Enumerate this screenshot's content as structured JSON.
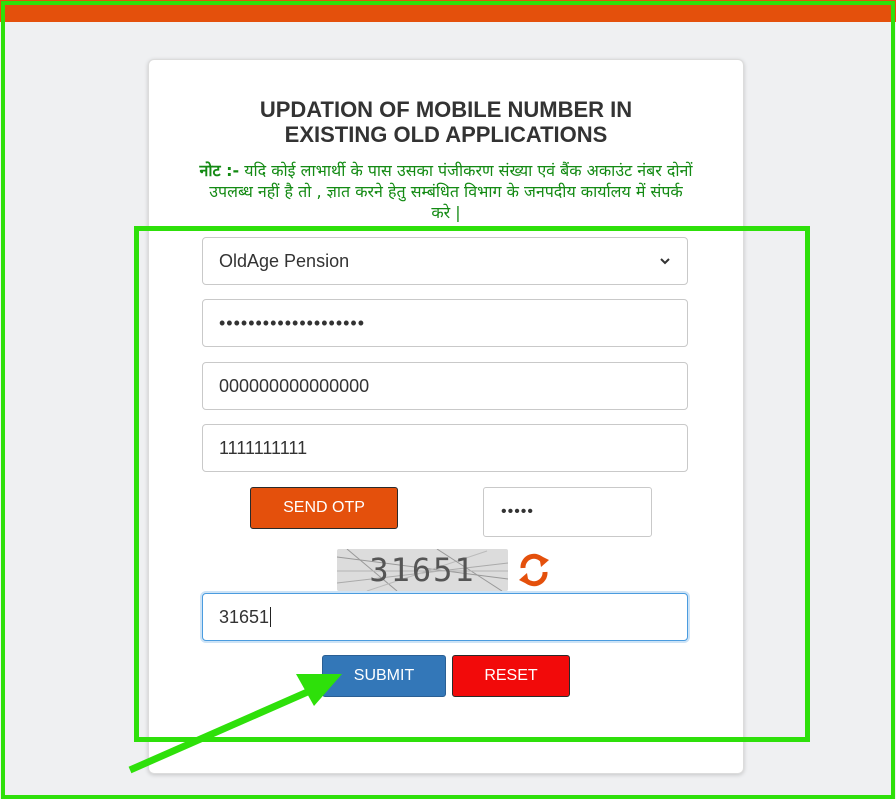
{
  "header": {
    "bar_color": "#e4500c"
  },
  "form": {
    "title_line1": "UPDATION OF MOBILE NUMBER IN",
    "title_line2": "EXISTING OLD APPLICATIONS",
    "note_label": "नोट :-",
    "note_text": " यदि कोई लाभार्थी के पास उसका पंजीकरण संख्या एवं बैंक अकाउंट नंबर दोनों उपलब्ध नहीं है तो , ज्ञात करने हेतु सम्बंधित विभाग के जनपदीय कार्यालय में संपर्क करे |",
    "scheme_select": {
      "selected": "OldAge Pension"
    },
    "registration_field": {
      "value": "••••••••••••••••••••"
    },
    "account_field": {
      "value": "000000000000000"
    },
    "mobile_field": {
      "value": "1111111111"
    },
    "send_otp_label": "SEND OTP",
    "otp_field": {
      "value": "•••••"
    },
    "captcha_image_text": "31651",
    "captcha_input": {
      "value": "31651"
    },
    "submit_label": "SUBMIT",
    "reset_label": "RESET"
  },
  "colors": {
    "accent_orange": "#e4500c",
    "submit_blue": "#3377b8",
    "reset_red": "#f20a0a",
    "note_green": "#138a13",
    "annotation_green": "#2ee00a"
  },
  "icons": {
    "dropdown": "chevron-down-icon",
    "captcha_refresh": "refresh-icon"
  }
}
